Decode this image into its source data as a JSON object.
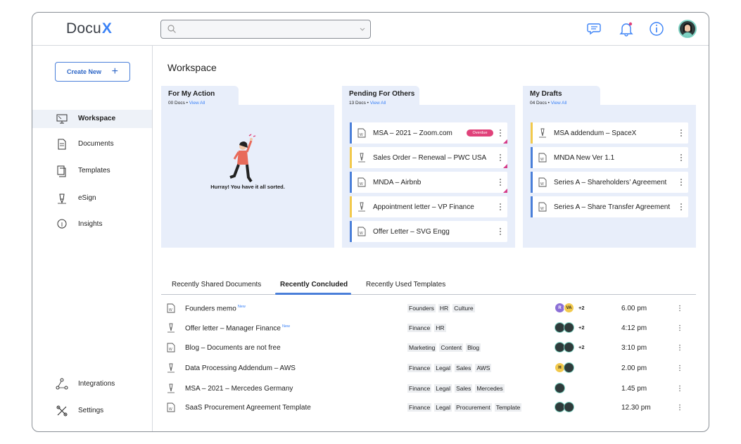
{
  "header": {
    "logo_text": "Docu",
    "logo_accent": "X",
    "search_placeholder": ""
  },
  "sidebar": {
    "create_label": "Create New",
    "items": [
      {
        "label": "Workspace",
        "icon": "desktop-icon",
        "active": true
      },
      {
        "label": "Documents",
        "icon": "document-icon"
      },
      {
        "label": "Templates",
        "icon": "templates-icon"
      },
      {
        "label": "eSign",
        "icon": "pen-icon"
      },
      {
        "label": "Insights",
        "icon": "lightbulb-icon"
      }
    ],
    "bottom_items": [
      {
        "label": "Integrations",
        "icon": "integrations-icon"
      },
      {
        "label": "Settings",
        "icon": "settings-icon"
      }
    ]
  },
  "workspace": {
    "title": "Workspace",
    "cards": [
      {
        "title": "For My Action",
        "count": "00 Docs",
        "view_all": "View All",
        "empty_message": "Hurray! You have it all sorted."
      },
      {
        "title": "Pending For Others",
        "count": "13 Docs",
        "view_all": "View All",
        "docs": [
          {
            "name": "MSA – 2021 – Zoom.com",
            "icon": "word-doc-icon",
            "bar_color": "#4a7fd9",
            "badge": "Overdue",
            "corner": true
          },
          {
            "name": "Sales Order – Renewal – PWC USA",
            "icon": "esign-icon",
            "bar_color": "#f2c94c",
            "corner": true
          },
          {
            "name": "MNDA – Airbnb",
            "icon": "word-doc-icon",
            "bar_color": "#4a7fd9",
            "corner": true
          },
          {
            "name": "Appointment letter – VP Finance",
            "icon": "esign-icon",
            "bar_color": "#f2c94c"
          },
          {
            "name": "Offer Letter – SVG Engg",
            "icon": "word-doc-icon",
            "bar_color": "#4a7fd9"
          }
        ]
      },
      {
        "title": "My Drafts",
        "count": "04 Docs",
        "view_all": "View All",
        "docs": [
          {
            "name": "MSA addendum – SpaceX",
            "icon": "esign-icon",
            "bar_color": "#f2c94c"
          },
          {
            "name": "MNDA New Ver 1.1",
            "icon": "word-doc-icon",
            "bar_color": "#4a7fd9"
          },
          {
            "name": "Series A – Shareholders’ Agreement",
            "icon": "word-doc-icon",
            "bar_color": "#4a7fd9"
          },
          {
            "name": "Series A – Share Transfer Agreement",
            "icon": "word-doc-icon",
            "bar_color": "#4a7fd9"
          }
        ]
      }
    ]
  },
  "tabs": [
    {
      "label": "Recently Shared Documents"
    },
    {
      "label": "Recently Concluded",
      "active": true
    },
    {
      "label": "Recently Used Templates"
    }
  ],
  "rows": [
    {
      "name": "Founders memo",
      "new": "New",
      "icon": "word-doc-icon",
      "tags": [
        "Founders",
        "HR",
        "Culture"
      ],
      "avatars": [
        {
          "t": "R",
          "c": "#8b6fd6"
        },
        {
          "t": "VA",
          "c": "#f2c94c"
        }
      ],
      "more": "+2",
      "time": "6.00 pm"
    },
    {
      "name": "Offer letter – Manager Finance",
      "new": "New",
      "icon": "esign-icon",
      "tags": [
        "Finance",
        "HR"
      ],
      "avatars": [
        {
          "t": "",
          "c": "#2f3b3b"
        },
        {
          "t": "",
          "c": "#2f3b3b"
        }
      ],
      "more": "+2",
      "time": "4:12 pm"
    },
    {
      "name": "Blog – Documents are not free",
      "new": "",
      "icon": "word-doc-icon",
      "tags": [
        "Marketing",
        "Content",
        "Blog"
      ],
      "avatars": [
        {
          "t": "",
          "c": "#2f3b3b"
        },
        {
          "t": "",
          "c": "#2f3b3b"
        }
      ],
      "more": "+2",
      "time": "3:10 pm"
    },
    {
      "name": "Data Processing Addendum – AWS",
      "new": "",
      "icon": "esign-icon",
      "tags": [
        "Finance",
        "Legal",
        "Sales",
        "AWS"
      ],
      "avatars": [
        {
          "t": "H",
          "c": "#f2c94c"
        },
        {
          "t": "",
          "c": "#2f3b3b"
        }
      ],
      "more": "",
      "time": "2.00 pm"
    },
    {
      "name": "MSA – 2021 – Mercedes Germany",
      "new": "",
      "icon": "esign-icon",
      "tags": [
        "Finance",
        "Legal",
        "Sales",
        "Mercedes"
      ],
      "avatars": [
        {
          "t": "",
          "c": "#2f3b3b"
        }
      ],
      "more": "",
      "time": "1.45 pm"
    },
    {
      "name": "SaaS Procurement Agreement Template",
      "new": "",
      "icon": "word-doc-icon",
      "tags": [
        "Finance",
        "Legal",
        "Procurement",
        "Template"
      ],
      "avatars": [
        {
          "t": "",
          "c": "#2f3b3b"
        },
        {
          "t": "",
          "c": "#2f3b3b"
        }
      ],
      "more": "",
      "time": "12.30 pm"
    }
  ]
}
